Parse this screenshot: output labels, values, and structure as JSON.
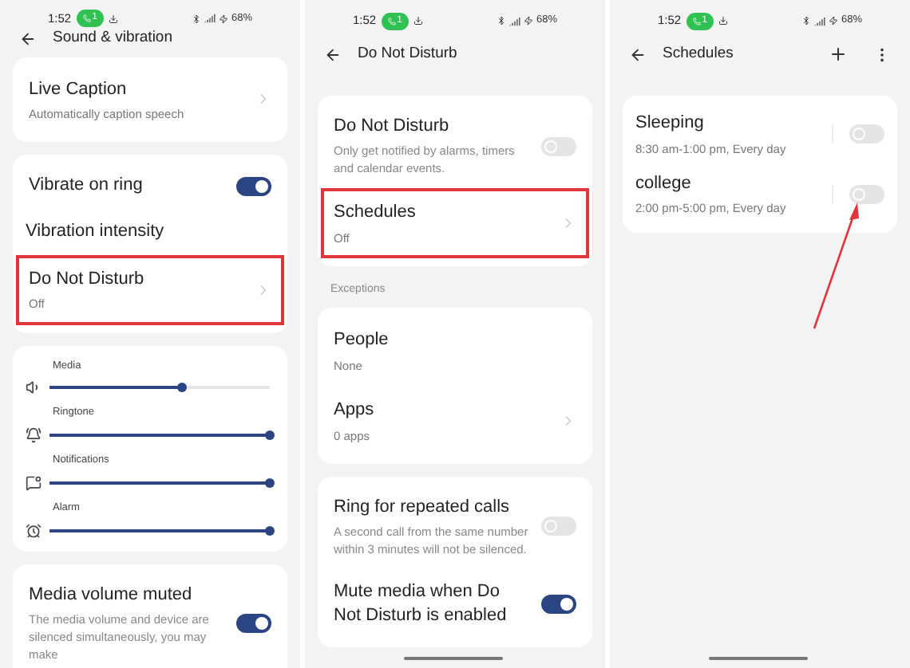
{
  "panels": [
    {
      "status": {
        "time": "1:52",
        "badge": "1",
        "battery": "68%"
      },
      "title": "Sound & vibration",
      "has_actions": false,
      "home_bar": false,
      "arrow": false,
      "groups": [
        {
          "items": [
            {
              "kind": "nav",
              "title": "Live Caption",
              "subtitle": "Automatically caption speech",
              "highlighted": false
            }
          ]
        },
        {
          "items": [
            {
              "kind": "toggle",
              "title": "Vibrate on ring",
              "on": true,
              "highlighted": false
            },
            {
              "kind": "plain",
              "title": "Vibration intensity"
            },
            {
              "kind": "nav",
              "title": "Do Not Disturb",
              "subtitle": "Off",
              "highlighted": true
            }
          ]
        },
        {
          "items": [
            {
              "kind": "slider",
              "label": "Media",
              "level": 0.6
            },
            {
              "kind": "slider",
              "label": "Ringtone",
              "level": 1
            },
            {
              "kind": "slider",
              "label": "Notifications",
              "level": 1
            },
            {
              "kind": "slider",
              "label": "Alarm",
              "level": 1
            }
          ]
        },
        {
          "items": [
            {
              "kind": "toggle",
              "title": "Media volume muted",
              "subtitle": "The media volume and device are silenced simultaneously, you may make",
              "on": true,
              "highlighted": false
            }
          ]
        }
      ]
    },
    {
      "status": {
        "time": "1:52",
        "badge": "1",
        "battery": "68%"
      },
      "title": "Do Not Disturb",
      "has_actions": false,
      "home_bar": true,
      "arrow": false,
      "groups": [
        {
          "items": [
            {
              "kind": "toggle",
              "title": "Do Not Disturb",
              "subtitle": "Only get notified by alarms, timers and calendar events.",
              "on": false,
              "highlighted": false
            },
            {
              "kind": "nav",
              "title": "Schedules",
              "subtitle": "Off",
              "highlighted": true
            }
          ]
        },
        {
          "label": "Exceptions",
          "items": [
            {
              "kind": "nav",
              "title": "People",
              "subtitle": "None",
              "chevron": false,
              "highlighted": false
            },
            {
              "kind": "nav",
              "title": "Apps",
              "subtitle": "0 apps",
              "highlighted": false
            }
          ]
        },
        {
          "items": [
            {
              "kind": "toggle",
              "title": "Ring for repeated calls",
              "subtitle": "A second call from the same number within 3 minutes will not be silenced.",
              "on": false,
              "highlighted": false
            },
            {
              "kind": "toggle",
              "title": "Mute media when Do Not Disturb is enabled",
              "on": true,
              "highlighted": false
            }
          ]
        }
      ]
    },
    {
      "status": {
        "time": "1:52",
        "badge": "1",
        "battery": "68%"
      },
      "title": "Schedules",
      "has_actions": true,
      "home_bar": true,
      "arrow": true,
      "groups": [
        {
          "items": [
            {
              "kind": "schedule",
              "title": "Sleeping",
              "subtitle": "8:30 am-1:00 pm, Every day",
              "on": false
            },
            {
              "kind": "schedule",
              "title": "college",
              "subtitle": "2:00 pm-5:00 pm, Every day",
              "on": false
            }
          ]
        }
      ]
    }
  ]
}
